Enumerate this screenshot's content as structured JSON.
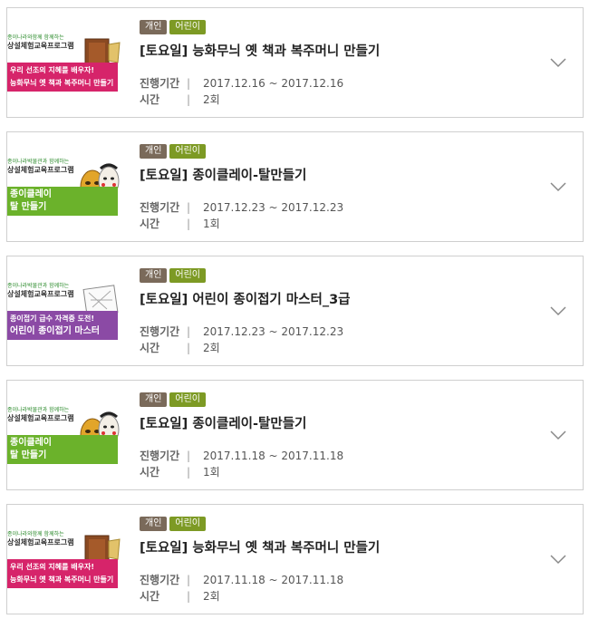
{
  "labels": {
    "period": "진행기간",
    "time": "시간",
    "sep": "|"
  },
  "items": [
    {
      "badge_a": "개인",
      "badge_b": "어린이",
      "title": "[토요일] 능화무늬 옛 책과 복주머니 만들기",
      "period": "2017.12.16 ~ 2017.12.16",
      "count": "2회",
      "thumb_small": "종이나라와함께 함께하는",
      "thumb_big": "상설체험교육프로그램",
      "band_line1": "우리 선조의 지혜를 배우자!",
      "band_line2": "능화무늬 옛 책과 복주머니 만들기",
      "band_color": "#d6246a"
    },
    {
      "badge_a": "개인",
      "badge_b": "어린이",
      "title": "[토요일] 종이클레이-탈만들기",
      "period": "2017.12.23 ~ 2017.12.23",
      "count": "1회",
      "thumb_small": "종이나라박물관과 함께하는",
      "thumb_big": "상설체험교육프로그램",
      "band_line1": "종이클레이",
      "band_line2": "탈 만들기",
      "band_color": "#6bb22b"
    },
    {
      "badge_a": "개인",
      "badge_b": "어린이",
      "title": "[토요일] 어린이 종이접기 마스터_3급",
      "period": "2017.12.23 ~ 2017.12.23",
      "count": "2회",
      "thumb_small": "종이나라박물관과 함께하는",
      "thumb_big": "상설체험교육프로그램",
      "band_line1": "종이접기 급수 자격증 도전!",
      "band_line2": "어린이 종이접기 마스터",
      "band_color": "#8b4aa5"
    },
    {
      "badge_a": "개인",
      "badge_b": "어린이",
      "title": "[토요일] 종이클레이-탈만들기",
      "period": "2017.11.18 ~ 2017.11.18",
      "count": "1회",
      "thumb_small": "종이나라박물관과 함께하는",
      "thumb_big": "상설체험교육프로그램",
      "band_line1": "종이클레이",
      "band_line2": "탈 만들기",
      "band_color": "#6bb22b"
    },
    {
      "badge_a": "개인",
      "badge_b": "어린이",
      "title": "[토요일] 능화무늬 옛 책과 복주머니 만들기",
      "period": "2017.11.18 ~ 2017.11.18",
      "count": "2회",
      "thumb_small": "종이나라와함께 함께하는",
      "thumb_big": "상설체험교육프로그램",
      "band_line1": "우리 선조의 지혜를 배우자!",
      "band_line2": "능화무늬 옛 책과 복주머니 만들기",
      "band_color": "#d6246a"
    }
  ]
}
